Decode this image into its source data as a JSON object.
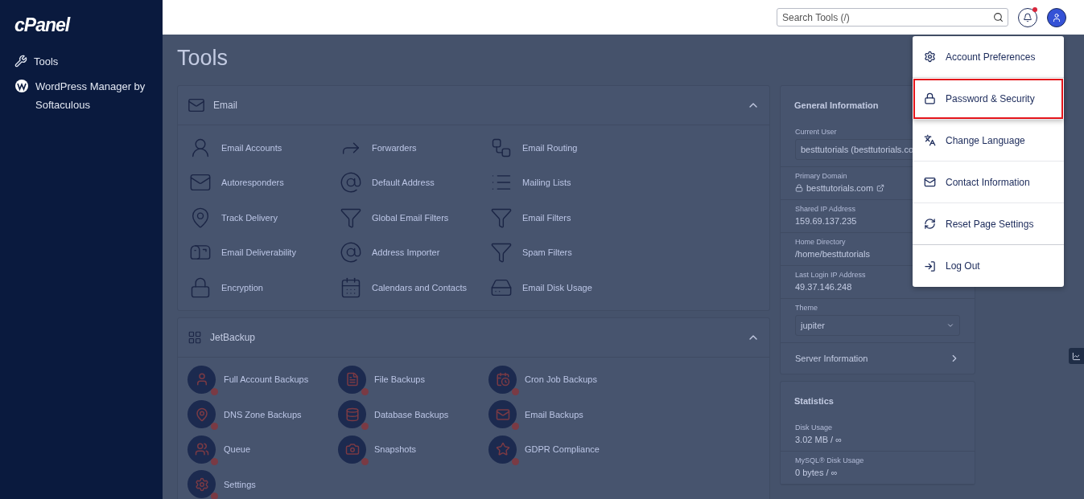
{
  "sidebar": {
    "logo": "cPanel",
    "items": [
      {
        "kind": "tools",
        "label": "Tools"
      },
      {
        "kind": "wordpress",
        "label": "WordPress Manager by Softaculous"
      }
    ]
  },
  "header": {
    "search": {
      "placeholder": "Search Tools (/)"
    },
    "notifications": {
      "unread": true
    }
  },
  "page_title": "Tools",
  "sections": [
    {
      "kind": "email",
      "title": "Email",
      "expanded": true,
      "items": [
        "Email Accounts",
        "Forwarders",
        "Email Routing",
        "Autoresponders",
        "Default Address",
        "Mailing Lists",
        "Track Delivery",
        "Global Email Filters",
        "Email Filters",
        "Email Deliverability",
        "Address Importer",
        "Spam Filters",
        "Encryption",
        "Calendars and Contacts",
        "Email Disk Usage"
      ]
    },
    {
      "kind": "jetbackup",
      "title": "JetBackup",
      "expanded": true,
      "items": [
        "Full Account Backups",
        "File Backups",
        "Cron Job Backups",
        "DNS Zone Backups",
        "Database Backups",
        "Email Backups",
        "Queue",
        "Snapshots",
        "GDPR Compliance",
        "Settings"
      ]
    }
  ],
  "general_information": {
    "title": "General Information",
    "fields": [
      {
        "kind": "select",
        "label": "Current User",
        "value": "besttutorials (besttutorials.co"
      },
      {
        "kind": "link",
        "label": "Primary Domain",
        "value": "besttutorials.com"
      },
      {
        "kind": "text",
        "label": "Shared IP Address",
        "value": "159.69.137.235"
      },
      {
        "kind": "text",
        "label": "Home Directory",
        "value": "/home/besttutorials"
      },
      {
        "kind": "text",
        "label": "Last Login IP Address",
        "value": "49.37.146.248"
      },
      {
        "kind": "dropdown",
        "label": "Theme",
        "value": "jupiter"
      }
    ],
    "server_information": "Server Information"
  },
  "statistics": {
    "title": "Statistics",
    "fields": [
      {
        "label": "Disk Usage",
        "value": "3.02 MB / ∞"
      },
      {
        "label": "MySQL® Disk Usage",
        "value": "0 bytes / ∞"
      }
    ]
  },
  "user_menu": {
    "open": true,
    "items": [
      {
        "label": "Account Preferences",
        "selected": false
      },
      {
        "label": "Password & Security",
        "selected": true
      },
      {
        "label": "Change Language",
        "selected": false
      },
      {
        "label": "Contact Information",
        "selected": false
      },
      {
        "label": "Reset Page Settings",
        "selected": false
      },
      {
        "label": "Log Out",
        "selected": false
      }
    ]
  }
}
